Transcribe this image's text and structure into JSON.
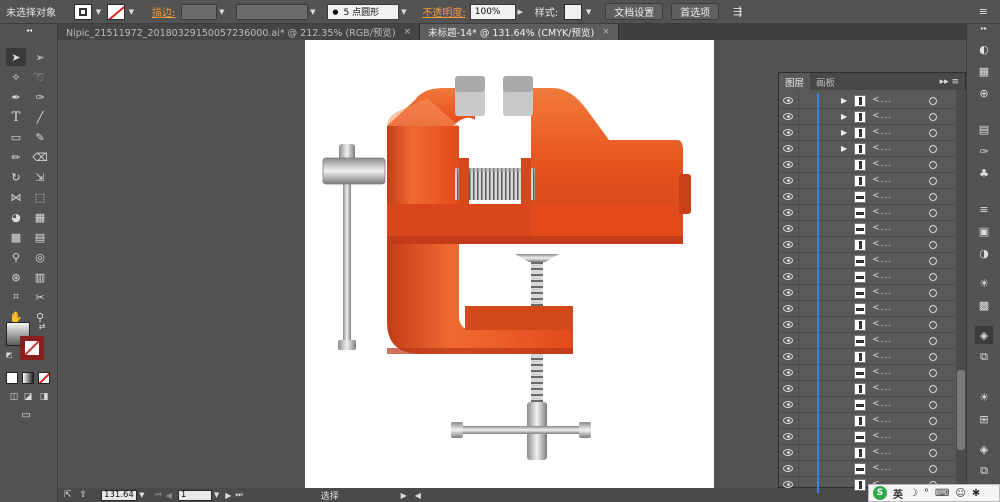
{
  "control_bar": {
    "selection_label": "未选择对象",
    "stroke_label": "描边:",
    "brush_label": "5 点圆形",
    "opacity_label": "不透明度:",
    "opacity_value": "100%",
    "style_label": "样式:",
    "doc_setup_button": "文档设置",
    "preferences_button": "首选项"
  },
  "tabs": [
    {
      "label": "Nipic_21511972_20180329150057236000.ai* @ 212.35% (RGB/预览)",
      "close": "×"
    },
    {
      "label": "未标题-14* @ 131.64% (CMYK/预览)",
      "close": "×"
    }
  ],
  "status_bar": {
    "zoom": "131.64",
    "artboard_number": "1",
    "tool_label": "选择"
  },
  "layers_panel": {
    "tabs": [
      "图层",
      "画板"
    ],
    "menu_glyph": "▸▸ ≡",
    "row_name": "<...",
    "rows": [
      {
        "expand": true,
        "thumb": "mark"
      },
      {
        "expand": true,
        "thumb": "mark"
      },
      {
        "expand": true,
        "thumb": "mark"
      },
      {
        "expand": true,
        "thumb": "mark"
      },
      {
        "expand": false,
        "thumb": "mark"
      },
      {
        "expand": false,
        "thumb": "mark"
      },
      {
        "expand": false,
        "thumb": "bar"
      },
      {
        "expand": false,
        "thumb": "bar"
      },
      {
        "expand": false,
        "thumb": "bar"
      },
      {
        "expand": false,
        "thumb": "mark"
      },
      {
        "expand": false,
        "thumb": "bar"
      },
      {
        "expand": false,
        "thumb": "bar"
      },
      {
        "expand": false,
        "thumb": "bar"
      },
      {
        "expand": false,
        "thumb": "bar"
      },
      {
        "expand": false,
        "thumb": "mark"
      },
      {
        "expand": false,
        "thumb": "bar"
      },
      {
        "expand": false,
        "thumb": "mark"
      },
      {
        "expand": false,
        "thumb": "bar"
      },
      {
        "expand": false,
        "thumb": "mark"
      },
      {
        "expand": false,
        "thumb": "bar"
      },
      {
        "expand": false,
        "thumb": "mark"
      },
      {
        "expand": false,
        "thumb": "bar"
      },
      {
        "expand": false,
        "thumb": "mark"
      },
      {
        "expand": false,
        "thumb": "bar"
      },
      {
        "expand": false,
        "thumb": "mark"
      }
    ]
  },
  "ime": {
    "label": "英"
  },
  "colors": {
    "vise_orange": "#e8531f",
    "vise_dark": "#b8381a",
    "steel": "#b9b9b9",
    "layer_blue": "#3d7fe6"
  }
}
